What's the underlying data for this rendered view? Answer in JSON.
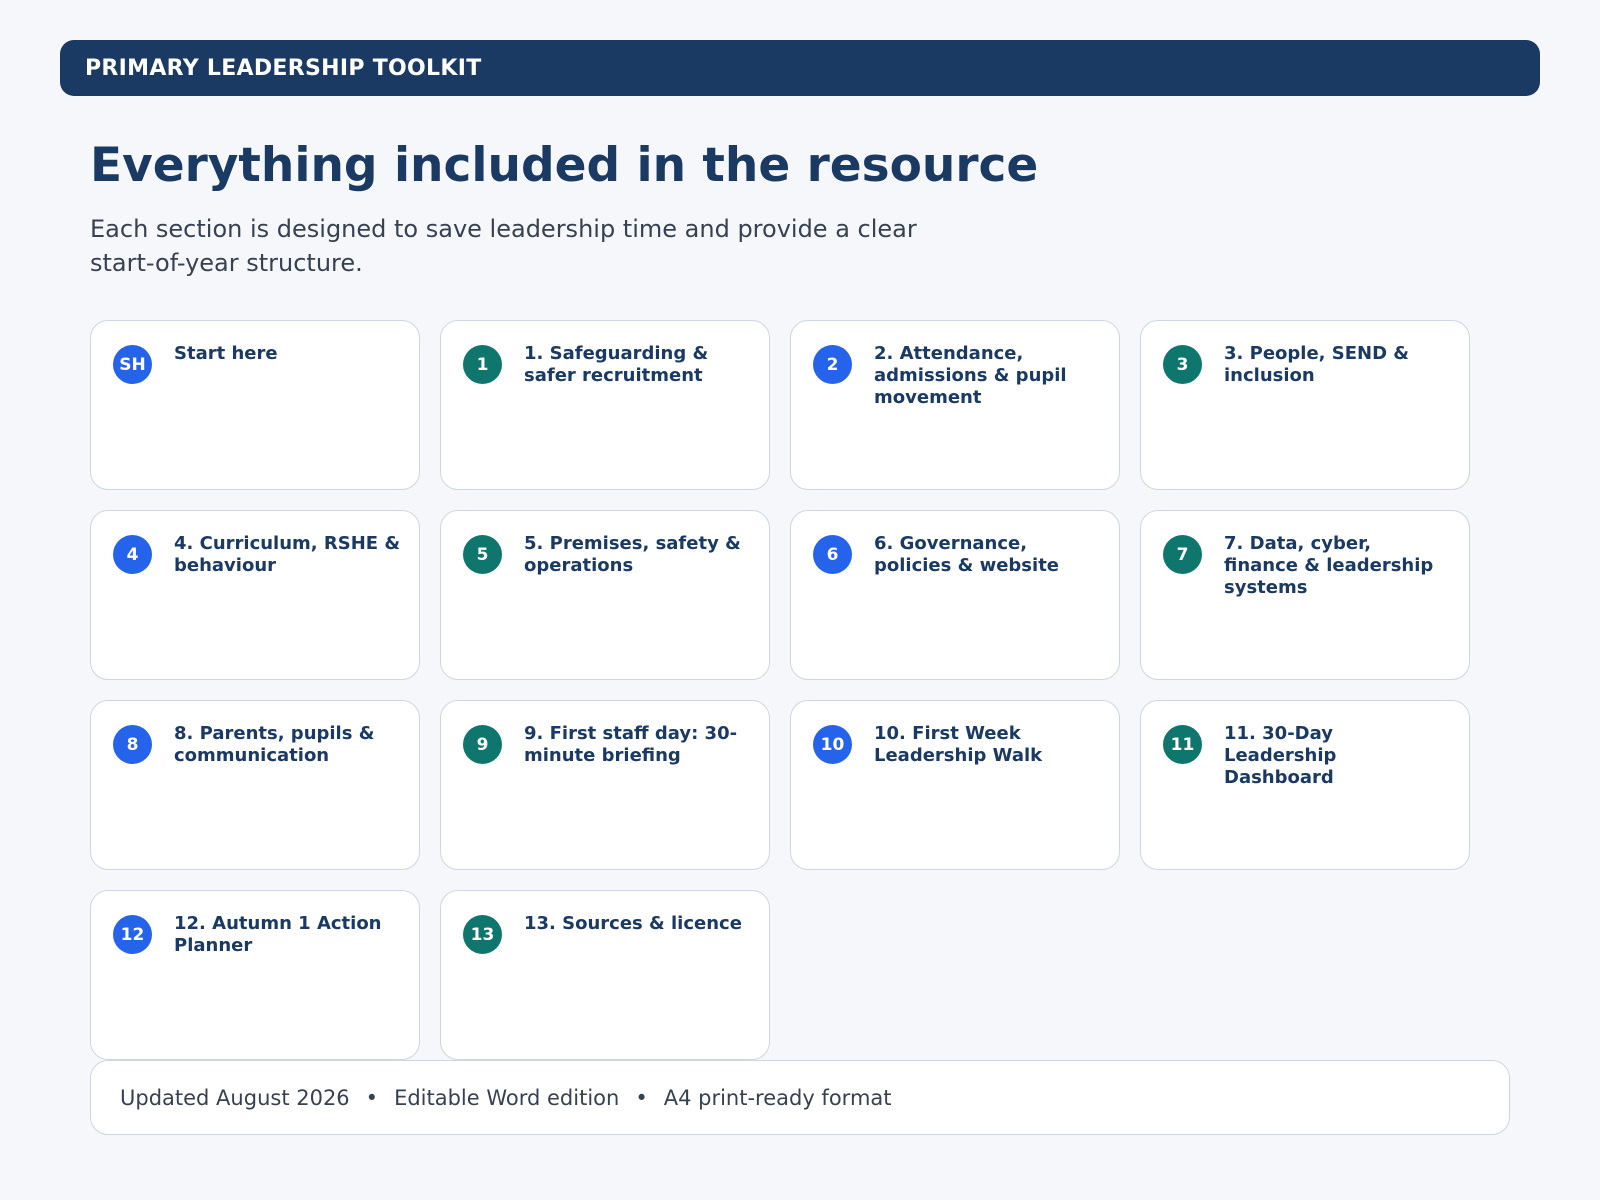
{
  "header": {
    "title": "PRIMARY LEADERSHIP TOOLKIT"
  },
  "main": {
    "title": "Everything included in the resource",
    "subtitle": "Each section is designed to save leadership time and provide a clear start-of-year structure."
  },
  "cards": [
    {
      "badge": "SH",
      "title": "Start here",
      "badge_color": "#2563eb"
    },
    {
      "badge": "1",
      "title": "1. Safeguarding & safer recruitment",
      "badge_color": "#0f766e"
    },
    {
      "badge": "2",
      "title": "2. Attendance, admissions & pupil movement",
      "badge_color": "#2563eb"
    },
    {
      "badge": "3",
      "title": "3. People, SEND & inclusion",
      "badge_color": "#0f766e"
    },
    {
      "badge": "4",
      "title": "4. Curriculum, RSHE & behaviour",
      "badge_color": "#2563eb"
    },
    {
      "badge": "5",
      "title": "5. Premises, safety & operations",
      "badge_color": "#0f766e"
    },
    {
      "badge": "6",
      "title": "6. Governance, policies & website",
      "badge_color": "#2563eb"
    },
    {
      "badge": "7",
      "title": "7. Data, cyber, finance & leadership systems",
      "badge_color": "#0f766e"
    },
    {
      "badge": "8",
      "title": "8. Parents, pupils & communication",
      "badge_color": "#2563eb"
    },
    {
      "badge": "9",
      "title": "9. First staff day: 30-minute briefing",
      "badge_color": "#0f766e"
    },
    {
      "badge": "10",
      "title": "10. First Week Leadership Walk",
      "badge_color": "#2563eb"
    },
    {
      "badge": "11",
      "title": "11. 30-Day Leadership Dashboard",
      "badge_color": "#0f766e"
    },
    {
      "badge": "12",
      "title": "12. Autumn 1 Action Planner",
      "badge_color": "#2563eb"
    },
    {
      "badge": "13",
      "title": "13. Sources & licence",
      "badge_color": "#0f766e"
    }
  ],
  "footer": {
    "updated": "Updated August 2026",
    "edition": "Editable Word edition",
    "format": "A4 print-ready format",
    "separator": "•"
  },
  "colors": {
    "header_bg": "#1a3a63",
    "title": "#1a3a63",
    "badge_blue": "#2563eb",
    "badge_teal": "#0f766e",
    "page_bg": "#f5f7fa",
    "card_border": "#cdd6e2"
  }
}
